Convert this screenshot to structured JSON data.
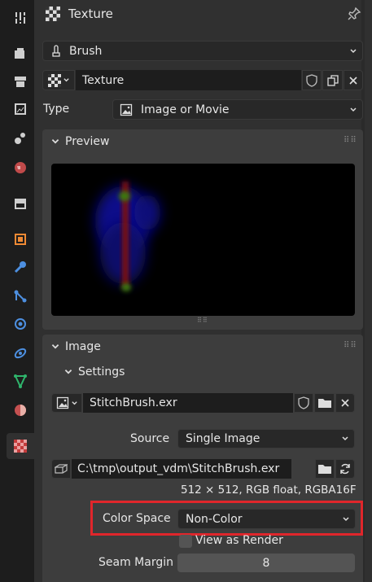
{
  "header": {
    "title": "Texture",
    "title_icon": "checker-icon",
    "pin_icon": "pin-icon"
  },
  "brush": {
    "label": "Brush",
    "icon": "brush-icon"
  },
  "texture": {
    "name": "Texture"
  },
  "type": {
    "label": "Type",
    "value": "Image or Movie"
  },
  "preview": {
    "label": "Preview"
  },
  "image_section": {
    "label": "Image",
    "settings_label": "Settings",
    "image_name": "StitchBrush.exr"
  },
  "source": {
    "label": "Source",
    "value": "Single Image"
  },
  "filepath": {
    "value": "C:\\tmp\\output_vdm\\StitchBrush.exr"
  },
  "image_info": "512 × 512,  RGB float, RGBA16F",
  "color_space": {
    "label": "Color Space",
    "value": "Non-Color",
    "highlight_color": "#e0262b"
  },
  "view_as_render": {
    "label": "View as Render",
    "checked": false
  },
  "seam_margin": {
    "label": "Seam Margin",
    "value": "8"
  },
  "tabs": [
    "tool",
    "render",
    "output",
    "view-layer",
    "scene",
    "world",
    "collection",
    "object",
    "modifiers",
    "particles",
    "physics",
    "constraints",
    "data",
    "material",
    "texture"
  ],
  "colors": {
    "panel": "#303030",
    "field": "#1d1d1d",
    "accent": "#e0262b"
  }
}
